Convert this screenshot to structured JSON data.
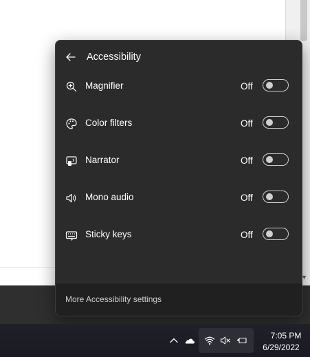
{
  "flyout": {
    "title": "Accessibility",
    "items": [
      {
        "label": "Magnifier",
        "state": "Off",
        "icon": "magnifier-icon"
      },
      {
        "label": "Color filters",
        "state": "Off",
        "icon": "color-filters-icon"
      },
      {
        "label": "Narrator",
        "state": "Off",
        "icon": "narrator-icon"
      },
      {
        "label": "Mono audio",
        "state": "Off",
        "icon": "mono-audio-icon"
      },
      {
        "label": "Sticky keys",
        "state": "Off",
        "icon": "sticky-keys-icon"
      }
    ],
    "footer_link": "More Accessibility settings"
  },
  "taskbar": {
    "time": "7:05 PM",
    "date": "6/29/2022",
    "tray_icons": [
      "chevron-up-icon",
      "onedrive-icon",
      "wifi-icon",
      "volume-muted-icon",
      "battery-charging-icon"
    ]
  },
  "colors": {
    "flyout_bg": "#2b2b2b",
    "footer_bg": "#202020",
    "taskbar_bg": "#1c1c24"
  }
}
